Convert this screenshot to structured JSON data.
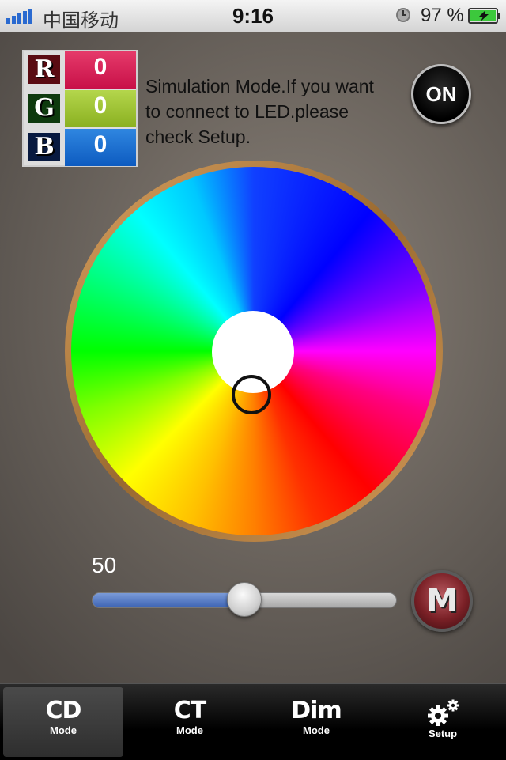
{
  "status_bar": {
    "carrier": "中国移动",
    "time": "9:16",
    "battery_percent": "97 %",
    "icons": [
      "signal-bars-icon",
      "alarm-clock-icon",
      "battery-charging-icon"
    ]
  },
  "rgb": {
    "r_label": "R",
    "r_value": "0",
    "g_label": "G",
    "g_value": "0",
    "b_label": "B",
    "b_value": "0"
  },
  "message": "Simulation Mode.If you want to connect to LED.please check Setup.",
  "power_button": "ON",
  "brightness": {
    "value": "50",
    "level": 0.5
  },
  "mode_button": "M",
  "tabs": [
    {
      "big": "CD",
      "small": "Mode",
      "active": true
    },
    {
      "big": "CT",
      "small": "Mode",
      "active": false
    },
    {
      "big": "Dim",
      "small": "Mode",
      "active": false
    },
    {
      "icon": "gear-icon",
      "small": "Setup",
      "active": false
    }
  ],
  "colors": {
    "red_value_bg": "#c81048",
    "green_value_bg": "#8ab020",
    "blue_value_bg": "#0d5bc0",
    "slider_fill": "#3e64b4"
  }
}
